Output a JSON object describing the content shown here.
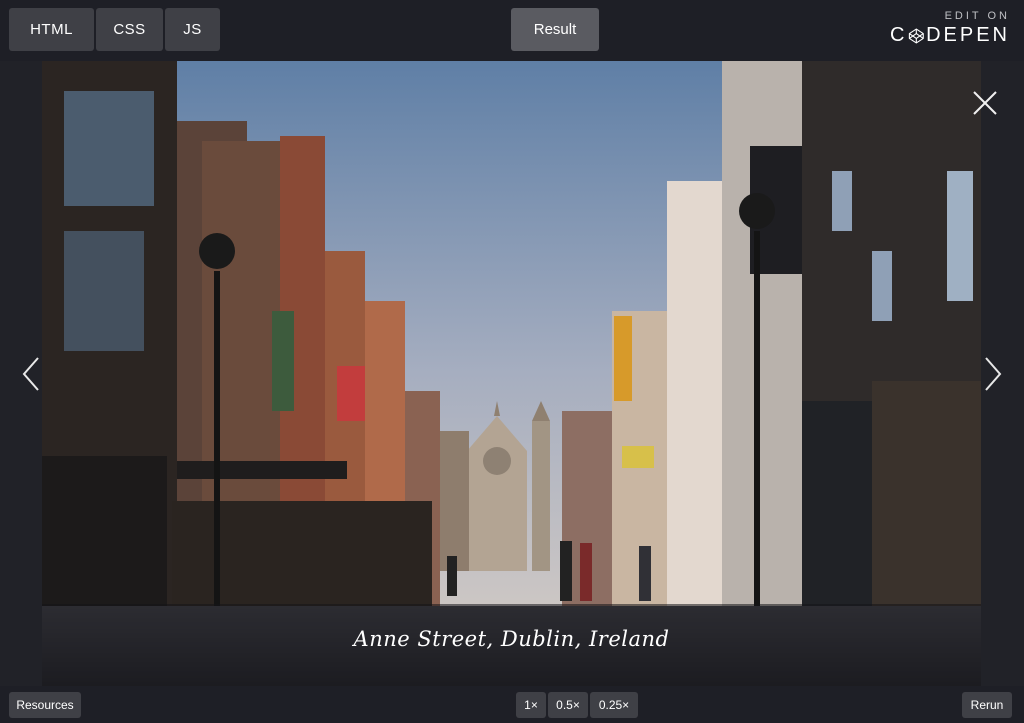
{
  "editor_tabs": {
    "html": "HTML",
    "css": "CSS",
    "js": "JS"
  },
  "result_tab": "Result",
  "codepen": {
    "edit_on": "EDIT ON",
    "brand_left": "C",
    "brand_right": "DEPEN",
    "logo_icon": "codepen-logo-icon"
  },
  "lightbox": {
    "caption": "Anne Street, Dublin, Ireland",
    "prev_icon": "chevron-left-icon",
    "next_icon": "chevron-right-icon",
    "close_icon": "close-icon"
  },
  "bottom_bar": {
    "resources": "Resources",
    "zoom": [
      "1×",
      "0.5×",
      "0.25×"
    ],
    "rerun": "Rerun"
  },
  "colors": {
    "background": "#1e1f26",
    "button": "#3f4046",
    "active_tab": "#5a5b61"
  }
}
